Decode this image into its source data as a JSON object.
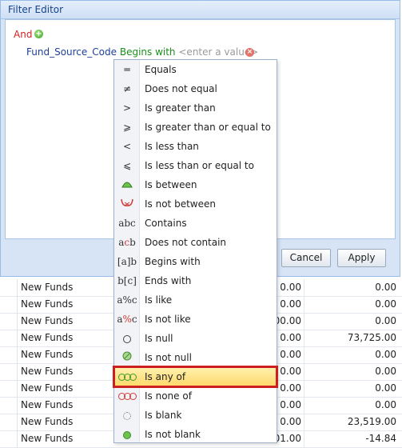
{
  "window": {
    "title": "Filter Editor"
  },
  "filter": {
    "group_operator": "And",
    "condition": {
      "field": "Fund_Source_Code",
      "operator": "Begins with",
      "value_placeholder": "<enter a value>"
    }
  },
  "buttons": {
    "cancel": "Cancel",
    "apply": "Apply"
  },
  "menu": {
    "selected_index": 15,
    "items": [
      {
        "label": "Equals",
        "icon": "equals-icon"
      },
      {
        "label": "Does not equal",
        "icon": "not-equal-icon"
      },
      {
        "label": "Is greater than",
        "icon": "greater-than-icon"
      },
      {
        "label": "Is greater than or equal to",
        "icon": "greater-equal-icon"
      },
      {
        "label": "Is less than",
        "icon": "less-than-icon"
      },
      {
        "label": "Is less than or equal to",
        "icon": "less-equal-icon"
      },
      {
        "label": "Is between",
        "icon": "between-icon"
      },
      {
        "label": "Is not between",
        "icon": "not-between-icon"
      },
      {
        "label": "Contains",
        "icon": "contains-icon"
      },
      {
        "label": "Does not contain",
        "icon": "not-contains-icon"
      },
      {
        "label": "Begins with",
        "icon": "begins-with-icon"
      },
      {
        "label": "Ends with",
        "icon": "ends-with-icon"
      },
      {
        "label": "Is like",
        "icon": "like-icon"
      },
      {
        "label": "Is not like",
        "icon": "not-like-icon"
      },
      {
        "label": "Is null",
        "icon": "null-icon"
      },
      {
        "label": "Is not null",
        "icon": "not-null-icon"
      },
      {
        "label": "Is any of",
        "icon": "any-of-icon"
      },
      {
        "label": "Is none of",
        "icon": "none-of-icon"
      },
      {
        "label": "Is blank",
        "icon": "blank-icon"
      },
      {
        "label": "Is not blank",
        "icon": "not-blank-icon"
      }
    ]
  },
  "grid": {
    "rows": [
      {
        "name": "New Funds",
        "col3": "0.00",
        "col4": "0.00"
      },
      {
        "name": "New Funds",
        "col3": "0.00",
        "col4": "0.00"
      },
      {
        "name": "New Funds",
        "col3": "00.00",
        "col4": "0.00"
      },
      {
        "name": "New Funds",
        "col3": "0.00",
        "col4": "73,725.00"
      },
      {
        "name": "New Funds",
        "col3": "0.00",
        "col4": "0.00"
      },
      {
        "name": "New Funds",
        "col3": "0.00",
        "col4": "0.00"
      },
      {
        "name": "New Funds",
        "col3": "0.00",
        "col4": "0.00"
      },
      {
        "name": "New Funds",
        "col3": "0.00",
        "col4": "0.00"
      },
      {
        "name": "New Funds",
        "col3": "0.00",
        "col4": "23,519.00"
      },
      {
        "name": "New Funds",
        "col3": "01.00",
        "col4": "-14.84"
      },
      {
        "name": "New Funds",
        "col3": "0.00",
        "col4": "0.00"
      }
    ]
  }
}
